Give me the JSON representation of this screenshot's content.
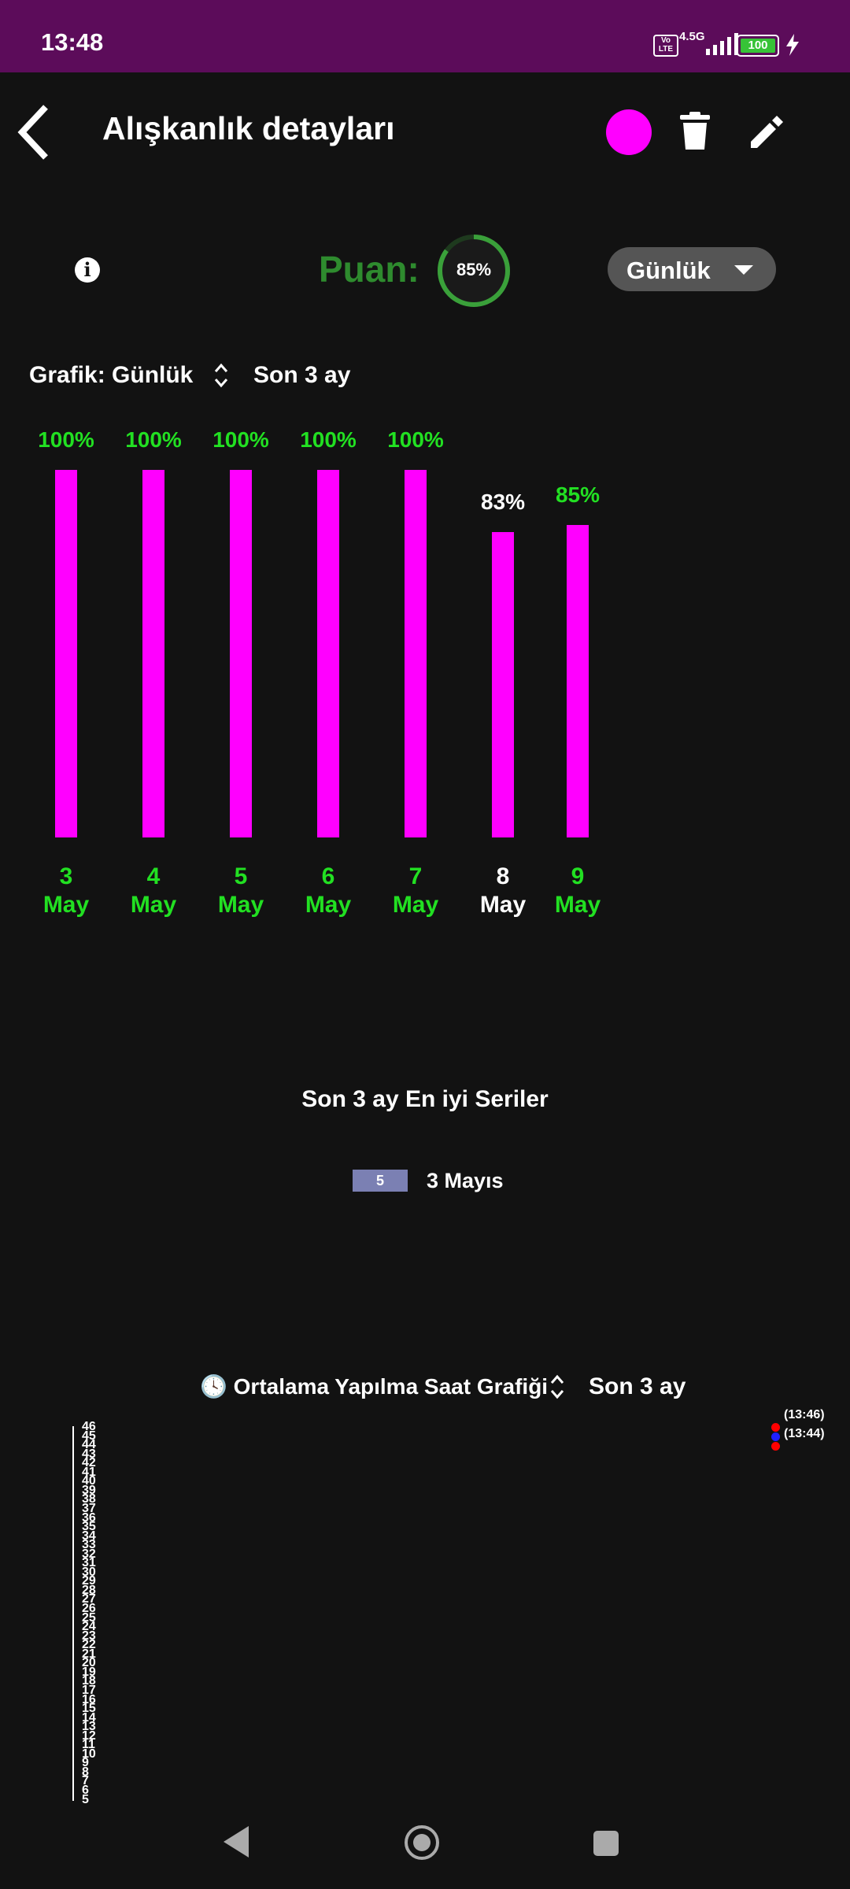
{
  "status_bar": {
    "time": "13:48",
    "network": "4.5G",
    "volte": "Vo LTE",
    "battery": "100"
  },
  "app_bar": {
    "title": "Alışkanlık detayları",
    "color_dot": "#ff00ff"
  },
  "score": {
    "label": "Puan:",
    "value": "85%",
    "progress": 0.85
  },
  "frequency_dropdown": {
    "selected": "Günlük"
  },
  "chart_header": {
    "label": "Grafik: Günlük",
    "range": "Son 3 ay"
  },
  "chart_data": {
    "type": "bar",
    "categories": [
      "3 May",
      "4 May",
      "5 May",
      "6 May",
      "7 May",
      "8 May",
      "9 May"
    ],
    "day_labels": [
      "3",
      "4",
      "5",
      "6",
      "7",
      "8",
      "9"
    ],
    "month_labels": [
      "May",
      "May",
      "May",
      "May",
      "May",
      "May",
      "May"
    ],
    "values": [
      100,
      100,
      100,
      100,
      100,
      83,
      85
    ],
    "value_labels": [
      "100%",
      "100%",
      "100%",
      "100%",
      "100%",
      "83%",
      "85%"
    ],
    "label_colors": [
      "#22e022",
      "#22e022",
      "#22e022",
      "#22e022",
      "#22e022",
      "#ffffff",
      "#22e022"
    ],
    "bar_color": "#ff00ff",
    "ylim": [
      0,
      100
    ]
  },
  "streaks": {
    "title": "Son 3 ay En iyi Seriler",
    "items": [
      {
        "count": "5",
        "date": "3 Mayıs"
      }
    ]
  },
  "time_chart": {
    "title": "🕓 Ortalama Yapılma Saat Grafiği",
    "range": "Son 3 ay",
    "y_ticks": [
      "46",
      "45",
      "44",
      "43",
      "42",
      "41",
      "40",
      "39",
      "38",
      "37",
      "36",
      "35",
      "34",
      "33",
      "32",
      "31",
      "30",
      "29",
      "28",
      "27",
      "26",
      "25",
      "24",
      "23",
      "22",
      "21",
      "20",
      "19",
      "18",
      "17",
      "16",
      "15",
      "14",
      "13",
      "12",
      "11",
      "10",
      "9",
      "8",
      "7",
      "6",
      "5"
    ],
    "points": [
      {
        "label": "(13:46)",
        "color": "#ff0000"
      },
      {
        "label": "(13:44)",
        "color": "#ff0000"
      }
    ],
    "avg_marker_color": "#2020ff"
  }
}
